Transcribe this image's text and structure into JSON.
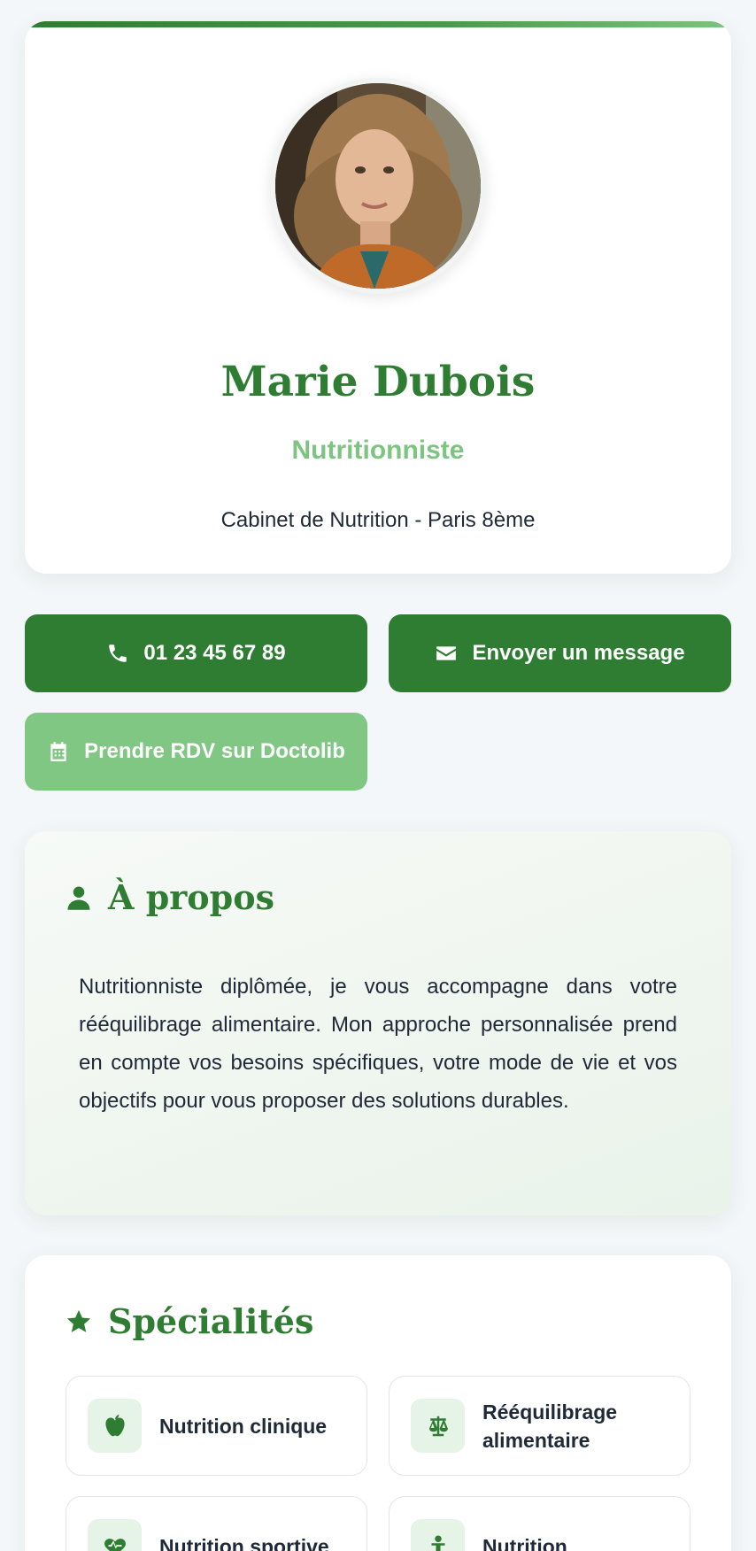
{
  "profile": {
    "name": "Marie Dubois",
    "title": "Nutritionniste",
    "cabinet": "Cabinet de Nutrition - Paris 8ème"
  },
  "actions": {
    "phone": "01 23 45 67 89",
    "message": "Envoyer un message",
    "rdv": "Prendre RDV sur Doctolib"
  },
  "about": {
    "heading": "À propos",
    "text": "Nutritionniste diplômée, je vous accompagne dans votre rééquilibrage alimentaire. Mon approche personnalisée prend en compte vos besoins spécifiques, votre mode de vie et vos objectifs pour vous proposer des solutions durables."
  },
  "specialties": {
    "heading": "Spécialités",
    "items": [
      {
        "label": "Nutrition clinique",
        "icon": "apple-icon"
      },
      {
        "label": "Rééquilibrage alimentaire",
        "icon": "scale-balance-icon"
      },
      {
        "label": "Nutrition sportive",
        "icon": "heart-pulse-icon"
      },
      {
        "label": "Nutrition",
        "icon": "person-icon"
      }
    ]
  },
  "colors": {
    "primary": "#2e7d32",
    "accent_light": "#81c784",
    "background": "#f4f7f9"
  }
}
